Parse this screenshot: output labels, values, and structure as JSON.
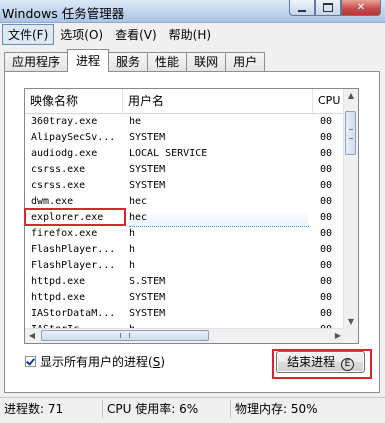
{
  "window": {
    "title": "Windows 任务管理器"
  },
  "menu": [
    "文件(F)",
    "选项(O)",
    "查看(V)",
    "帮助(H)"
  ],
  "tabs": [
    "应用程序",
    "进程",
    "服务",
    "性能",
    "联网",
    "用户"
  ],
  "active_tab": "进程",
  "columns": {
    "image": "映像名称",
    "user": "用户名",
    "cpu": "CPU"
  },
  "processes": [
    {
      "image": "360tray.exe",
      "user": "he",
      "cpu": "00"
    },
    {
      "image": "AlipaySecSv...",
      "user": "SYSTEM",
      "cpu": "00"
    },
    {
      "image": "audiodg.exe",
      "user": "LOCAL SERVICE",
      "cpu": "00"
    },
    {
      "image": "csrss.exe",
      "user": "SYSTEM",
      "cpu": "00"
    },
    {
      "image": "csrss.exe",
      "user": "SYSTEM",
      "cpu": "00"
    },
    {
      "image": "dwm.exe",
      "user": "hec",
      "cpu": "00"
    },
    {
      "image": "explorer.exe",
      "user": "hec",
      "cpu": "00"
    },
    {
      "image": "firefox.exe",
      "user": "h",
      "cpu": "00"
    },
    {
      "image": "FlashPlayer...",
      "user": "h",
      "cpu": "00"
    },
    {
      "image": "FlashPlayer...",
      "user": "h",
      "cpu": "00"
    },
    {
      "image": "httpd.exe",
      "user": "S.STEM",
      "cpu": "00"
    },
    {
      "image": "httpd.exe",
      "user": "SYSTEM",
      "cpu": "00"
    },
    {
      "image": "IAStorDataM...",
      "user": "SYSTEM",
      "cpu": "00"
    },
    {
      "image": "IAStorIc...",
      "user": "h",
      "cpu": "00"
    }
  ],
  "selected_row_index": 6,
  "show_all": {
    "label": "显示所有用户的进程",
    "hotkey": "S",
    "checked": true
  },
  "end_button": {
    "label": "结束进程",
    "hotkey": "E"
  },
  "status": {
    "processes": "进程数: 71",
    "cpu": "CPU 使用率: 6%",
    "memory": "物理内存: 50%"
  },
  "annotation_color": "#d9262c"
}
